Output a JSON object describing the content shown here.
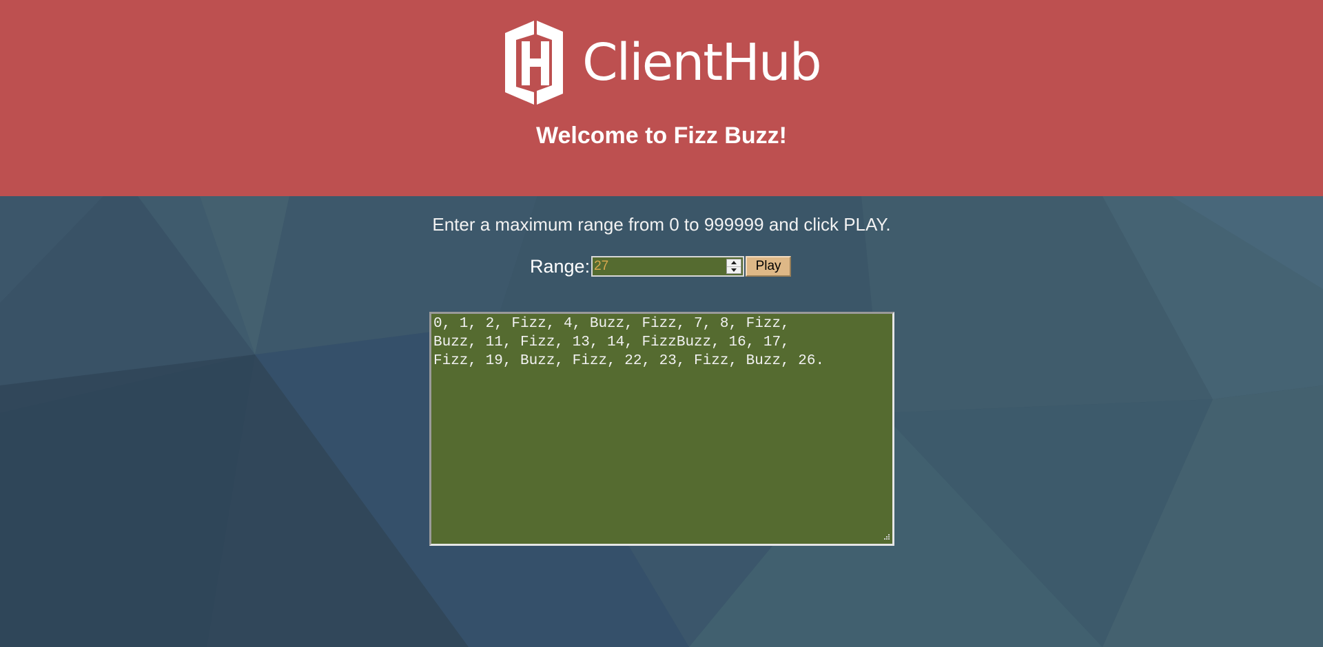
{
  "header": {
    "logo_text": "ClientHub",
    "welcome": "Welcome to Fizz Buzz!"
  },
  "main": {
    "instructions": "Enter a maximum range from 0 to 999999 and click PLAY.",
    "range_label": "Range:",
    "range_value": "27",
    "play_label": "Play",
    "output": "0, 1, 2, Fizz, 4, Buzz, Fizz, 7, 8, Fizz,\nBuzz, 11, Fizz, 13, 14, FizzBuzz, 16, 17,\nFizz, 19, Buzz, Fizz, 22, 23, Fizz, Buzz, 26."
  },
  "icons": {
    "logo": "clienthub-h-logo-icon",
    "spinner_up": "chevron-up-icon",
    "spinner_down": "chevron-down-icon",
    "resize": "resize-grip-icon"
  },
  "colors": {
    "header_bg": "#bd5050",
    "page_bg": "#3a5366",
    "field_bg": "#556b30",
    "button_bg": "#deb887",
    "input_text": "#d9a94e"
  }
}
